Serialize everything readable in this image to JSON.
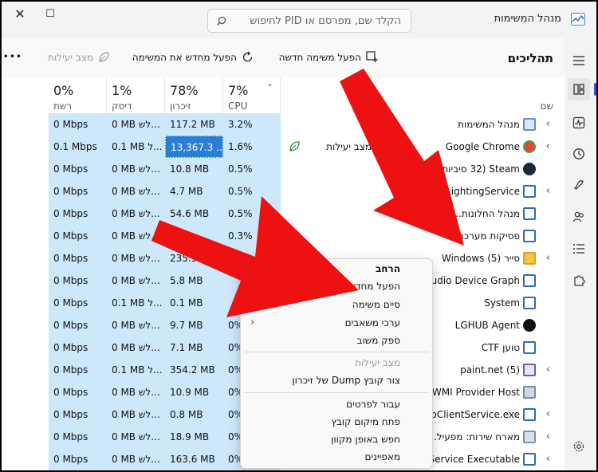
{
  "window": {
    "title": "מנהל המשימות",
    "search_placeholder": "הקלד שם, מפרסם או PID לחיפוש",
    "close_glyph": "✕",
    "max_glyph": "☐"
  },
  "toolbar": {
    "title": "תהליכים",
    "new_task": "הפעל משימה חדשה",
    "restart_task": "הפעל מחדש את המשימה",
    "efficiency": "מצב יעילות",
    "more": "•••"
  },
  "columns": {
    "name": "שם",
    "status": "",
    "cpu": {
      "pct": "7%",
      "label": "CPU"
    },
    "memory": {
      "pct": "78%",
      "label": "זיכרון"
    },
    "disk": {
      "pct": "1%",
      "label": "דיסק"
    },
    "network": {
      "pct": "0%",
      "label": "רשת"
    }
  },
  "rows": [
    {
      "name": "מנהל המשימות",
      "status": "",
      "cpu": "3.2%",
      "memory": "117.2 MB",
      "disk": "0 MB לש...",
      "network": "0 Mbps"
    },
    {
      "name": "Google Chrome",
      "status": "מצב יעילות",
      "cpu": "1.6%",
      "memory": "13,367.3 ...",
      "disk": "0.1 MB ל...",
      "network": "0.1 Mbps"
    },
    {
      "name": "Steam (32 סיביות)",
      "status": "",
      "cpu": "0.5%",
      "memory": "10.8 MB",
      "disk": "0 MB לש...",
      "network": "0 Mbps"
    },
    {
      "name": "LightingService",
      "status": "",
      "cpu": "0.5%",
      "memory": "4.7 MB",
      "disk": "0 MB לש...",
      "network": "0 Mbps"
    },
    {
      "name": "מנהל החלונות...",
      "status": "",
      "cpu": "0.5%",
      "memory": "54.6 MB",
      "disk": "0 MB לש...",
      "network": "0 Mbps"
    },
    {
      "name": "פסיקות מערכת",
      "status": "",
      "cpu": "0.3%",
      "memory": "",
      "disk": "0 MB לש...",
      "network": "0 Mbps"
    },
    {
      "name": "סייר Windows (5)",
      "status": "",
      "cpu": "",
      "memory": "235.9",
      "disk": "0 MB לש...",
      "network": "0 Mbps"
    },
    {
      "name": "Audio Device Graph",
      "status": "",
      "cpu": "",
      "memory": "5.8 MB",
      "disk": "0 MB לש...",
      "network": "0 Mbps"
    },
    {
      "name": "System",
      "status": "",
      "cpu": "",
      "memory": "0.1 MB",
      "disk": "0.1 MB ל...",
      "network": "0 Mbps"
    },
    {
      "name": "LGHUB Agent",
      "status": "",
      "cpu": "0%",
      "memory": "9.7 MB",
      "disk": "0 MB לש...",
      "network": "0 Mbps"
    },
    {
      "name": "טוען CTF",
      "status": "",
      "cpu": "0%",
      "memory": "7.1 MB",
      "disk": "0 MB לש...",
      "network": "0 Mbps"
    },
    {
      "name": "paint.net (5)",
      "status": "",
      "cpu": "0%",
      "memory": "354.2 MB",
      "disk": "0.1 MB ל...",
      "network": "0 Mbps"
    },
    {
      "name": "WMI Provider Host",
      "status": "",
      "cpu": "0%",
      "memory": "10.9 MB",
      "disk": "0 MB לש...",
      "network": "0 Mbps"
    },
    {
      "name": "UsbClientService.exe",
      "status": "",
      "cpu": "0%",
      "memory": "0.8 MB",
      "disk": "0 MB לש...",
      "network": "0 Mbps"
    },
    {
      "name": "מארח שירות: מפעיל...",
      "status": "",
      "cpu": "0%",
      "memory": "18.9 MB",
      "disk": "0 MB לש...",
      "network": "0 Mbps"
    },
    {
      "name": "Service Executable",
      "status": "",
      "cpu": "0%",
      "memory": "163.6 MB",
      "disk": "0 MB לש...",
      "network": "0 Mbps"
    }
  ],
  "context_menu": {
    "expand": "הרחב",
    "restart": "הפעל מחדש",
    "end_task": "סיים משימה",
    "resource_values": "ערכי משאבים",
    "feedback": "ספק משוב",
    "efficiency_mode": "מצב יעילות",
    "dump": "צור קובץ Dump של זיכרון",
    "details": "עבור לפרטים",
    "open_location": "פתח מיקום קובץ",
    "search_online": "חפש באופן מקוון",
    "properties": "מאפיינים"
  },
  "colors": {
    "accent": "#2b5ec8",
    "highlight": "#cde8fb",
    "arrow": "#ee1111"
  }
}
